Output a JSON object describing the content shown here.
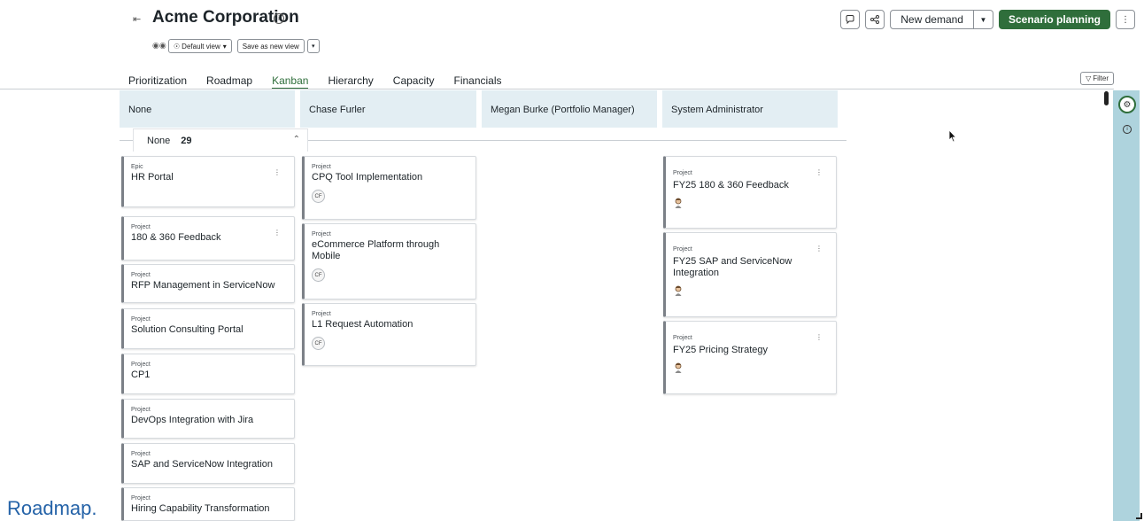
{
  "header": {
    "title": "Acme Corporation",
    "view_label": "Default view",
    "save_view_label": "Save as new view"
  },
  "toolbar": {
    "new_demand_label": "New demand",
    "scenario_label": "Scenario planning"
  },
  "tabs": [
    {
      "label": "Prioritization"
    },
    {
      "label": "Roadmap"
    },
    {
      "label": "Kanban"
    },
    {
      "label": "Hierarchy"
    },
    {
      "label": "Capacity"
    },
    {
      "label": "Financials"
    }
  ],
  "active_tab": "Kanban",
  "filter_label": "Filter",
  "columns": [
    {
      "label": "None"
    },
    {
      "label": "Chase Furler"
    },
    {
      "label": "Megan Burke (Portfolio Manager)"
    },
    {
      "label": "System Administrator"
    }
  ],
  "swimlane": {
    "label": "None",
    "count": "29"
  },
  "cards": {
    "none": [
      {
        "type": "Epic",
        "title": "HR Portal"
      },
      {
        "type": "Project",
        "title": "180 & 360 Feedback"
      },
      {
        "type": "Project",
        "title": "RFP Management in ServiceNow"
      },
      {
        "type": "Project",
        "title": "Solution Consulting Portal"
      },
      {
        "type": "Project",
        "title": "CP1"
      },
      {
        "type": "Project",
        "title": "DevOps Integration with Jira"
      },
      {
        "type": "Project",
        "title": "SAP and ServiceNow Integration"
      },
      {
        "type": "Project",
        "title": "Hiring Capability Transformation"
      }
    ],
    "chase": [
      {
        "type": "Project",
        "title": "CPQ Tool Implementation",
        "initials": "CF"
      },
      {
        "type": "Project",
        "title": "eCommerce Platform through Mobile",
        "initials": "CF"
      },
      {
        "type": "Project",
        "title": "L1 Request Automation",
        "initials": "CF"
      }
    ],
    "sysadmin": [
      {
        "type": "Project",
        "title": "FY25 180 & 360 Feedback"
      },
      {
        "type": "Project",
        "title": "FY25 SAP and ServiceNow Integration"
      },
      {
        "type": "Project",
        "title": "FY25 Pricing Strategy"
      }
    ]
  },
  "overlay_caption": "Roadmap.",
  "colors": {
    "accent_green": "#2f6e3b",
    "column_header_bg": "#e3eef3",
    "rail_bg": "#aed3dd",
    "caption_blue": "#2563a8"
  }
}
